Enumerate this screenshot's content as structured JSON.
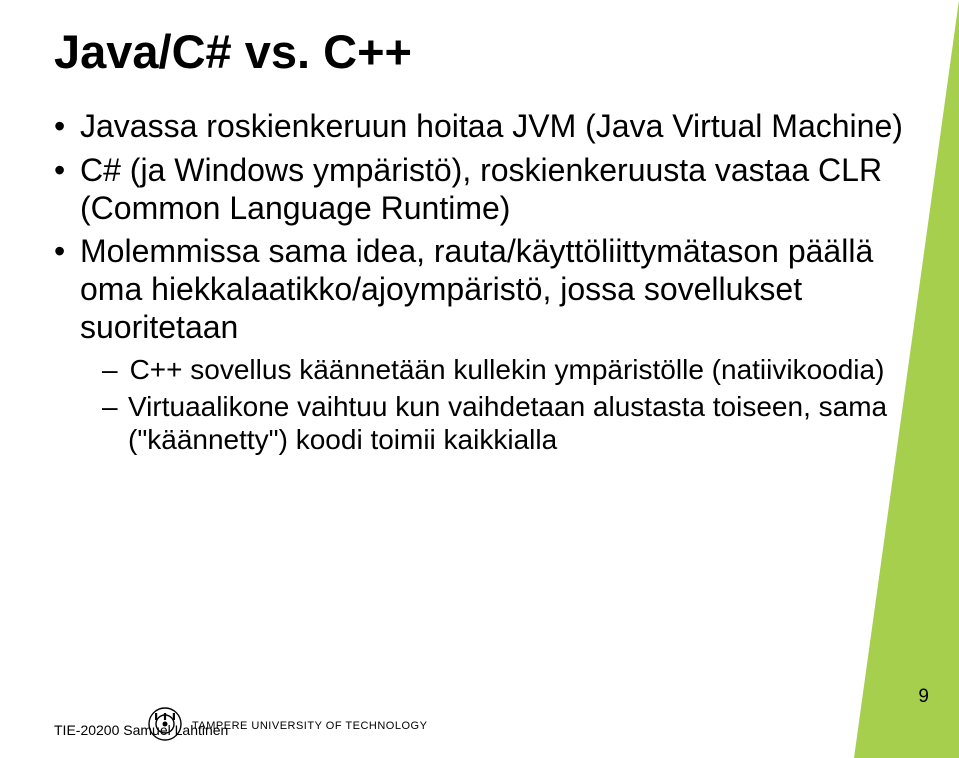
{
  "title": "Java/C# vs. C++",
  "bullets": [
    {
      "level": 1,
      "text": "Javassa roskienkeruun hoitaa JVM (Java Virtual Machine)"
    },
    {
      "level": 1,
      "text": "C# (ja Windows ympäristö), roskienkeruusta vastaa CLR (Common Language Runtime)"
    },
    {
      "level": 1,
      "text": "Molemmissa sama idea, rauta/käyttöliittymätason päällä oma hiekkalaatikko/ajoympäristö, jossa sovellukset suoritetaan"
    },
    {
      "level": 2,
      "text": "C++ sovellus käännetään kullekin ympäristölle (natiivikoodia)"
    },
    {
      "level": 2,
      "text": "Virtuaalikone vaihtuu kun vaihdetaan alustasta toiseen, sama (\"käännetty\") koodi toimii kaikkialla"
    }
  ],
  "footer": {
    "course": "TIE-20200 Samuel Lahtinen",
    "university": "TAMPERE UNIVERSITY OF TECHNOLOGY"
  },
  "page_number": "9",
  "colors": {
    "green": "#a5cf4c"
  }
}
